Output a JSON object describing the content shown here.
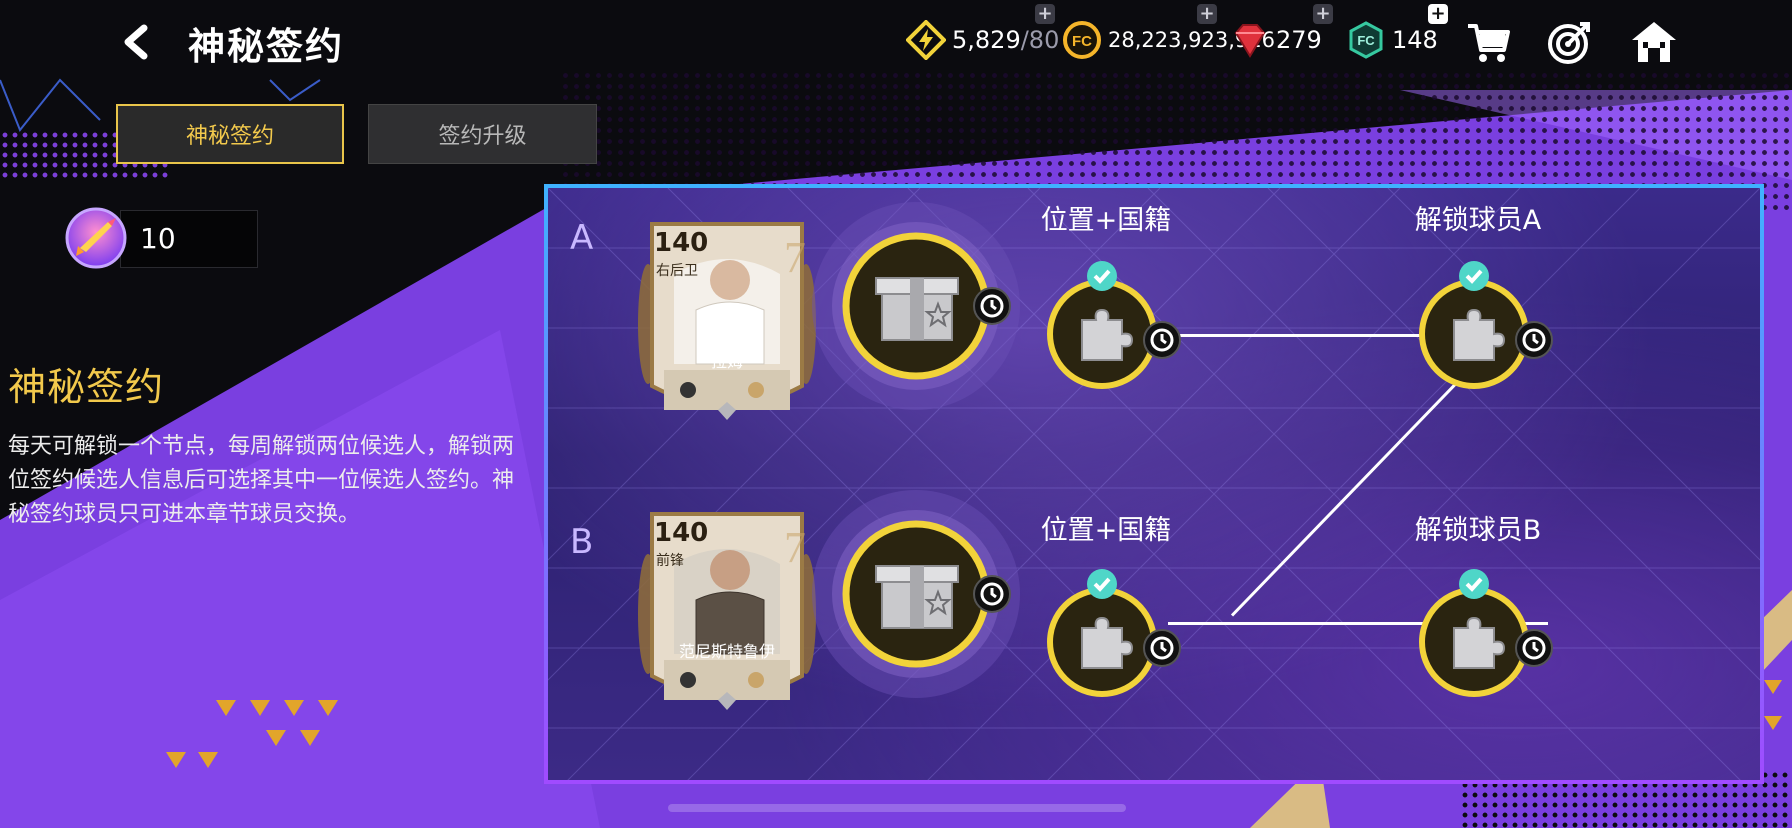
{
  "header": {
    "title": "神秘签约",
    "currencies": [
      {
        "name": "energy",
        "value": "5,829",
        "max": "/80",
        "color": "#f2d33a"
      },
      {
        "name": "coins",
        "value": "28,223,923,916",
        "color": "#f5b52a"
      },
      {
        "name": "gems",
        "value": "279",
        "color": "#e0313c"
      },
      {
        "name": "fc-points",
        "value": "148",
        "color": "#36c9a0"
      }
    ]
  },
  "tabs": [
    {
      "label": "神秘签约",
      "active": true
    },
    {
      "label": "签约升级",
      "active": false
    }
  ],
  "token": {
    "count": "10"
  },
  "description": {
    "title": "神秘签约",
    "text": "每天可解锁一个节点，每周解锁两位候选人，解锁两位签约候选人信息后可选择其中一位候选人签约。神秘签约球员只可进本章节球员交换。"
  },
  "rows": [
    {
      "letter": "A",
      "player": {
        "rating": "140",
        "position": "右后卫",
        "name": "拉姆"
      },
      "nodes": [
        {
          "label": "位置+国籍",
          "checked": true
        },
        {
          "label": "解锁球员A",
          "checked": true
        }
      ]
    },
    {
      "letter": "B",
      "player": {
        "rating": "140",
        "position": "前锋",
        "name": "范尼斯特鲁伊"
      },
      "nodes": [
        {
          "label": "位置+国籍",
          "checked": true
        },
        {
          "label": "解锁球员B",
          "checked": true
        }
      ]
    }
  ],
  "colors": {
    "accent": "#f2c94c",
    "panel_border_top": "#3fb2ff",
    "panel_border_bottom": "#a04bff",
    "check": "#4fd6c8"
  }
}
